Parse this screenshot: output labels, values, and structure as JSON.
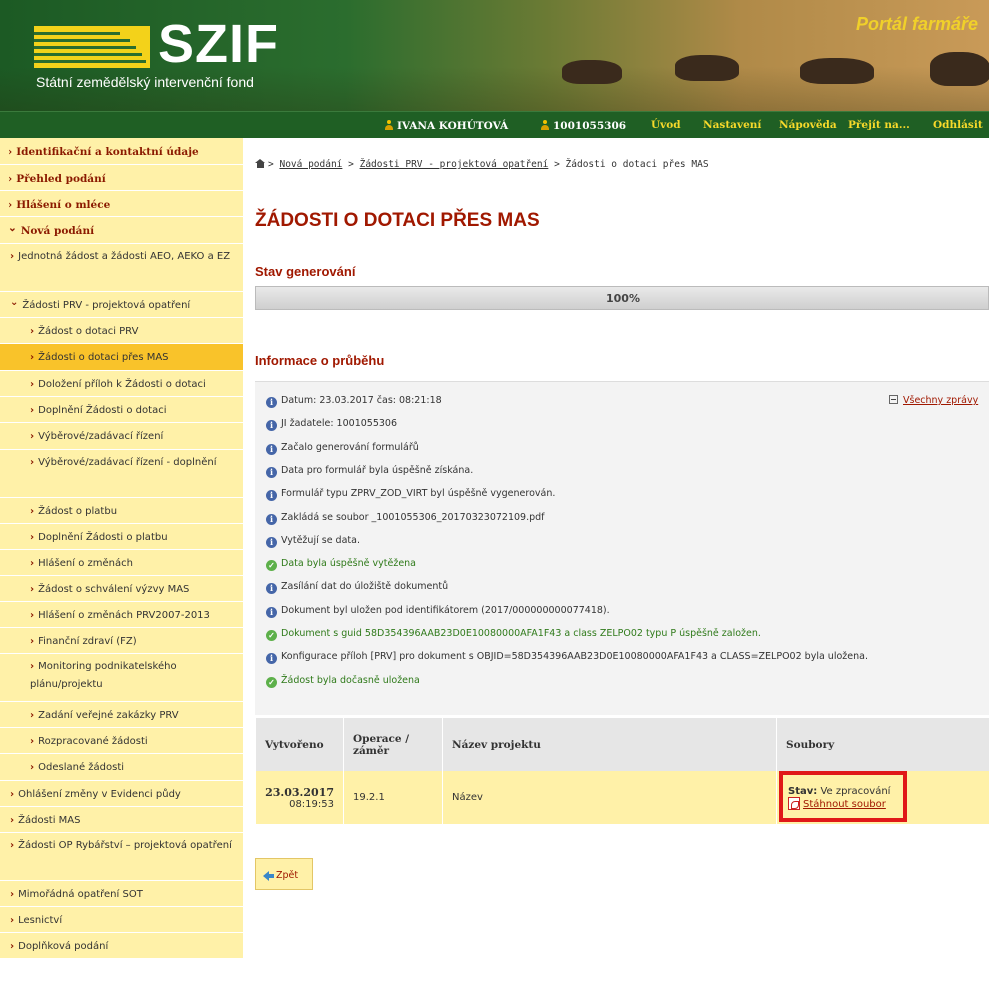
{
  "header": {
    "logo_text": "SZIF",
    "logo_subtitle": "Státní zemědělský intervenční fond",
    "portal_title": "Portál farmáře"
  },
  "navbar": {
    "user_name": "IVANA KOHÚTOVÁ",
    "user_id": "1001055306",
    "items": [
      "Úvod",
      "Nastavení",
      "Nápověda",
      "Přejít na...",
      "Odhlásit"
    ]
  },
  "sidebar": {
    "items": [
      {
        "label": "Identifikační a kontaktní údaje",
        "level": 0
      },
      {
        "label": "Přehled podání",
        "level": 0
      },
      {
        "label": "Hlášení o mléce",
        "level": 0
      },
      {
        "label": "Nová podání",
        "level": 0,
        "expanded": true
      },
      {
        "label": "Jednotná žádost a žádosti AEO, AEKO a EZ",
        "level": 1
      },
      {
        "label": "Žádosti PRV - projektová opatření",
        "level": 1,
        "expanded": true
      },
      {
        "label": "Žádost o dotaci PRV",
        "level": 2
      },
      {
        "label": "Žádosti o dotaci přes MAS",
        "level": 2,
        "active": true
      },
      {
        "label": "Doložení příloh k Žádosti o dotaci",
        "level": 2
      },
      {
        "label": "Doplnění Žádosti o dotaci",
        "level": 2
      },
      {
        "label": "Výběrové/zadávací řízení",
        "level": 2
      },
      {
        "label": "Výběrové/zadávací řízení - doplnění",
        "level": 2
      },
      {
        "label": "Žádost o platbu",
        "level": 2
      },
      {
        "label": "Doplnění Žádosti o platbu",
        "level": 2
      },
      {
        "label": "Hlášení o změnách",
        "level": 2
      },
      {
        "label": "Žádost o schválení výzvy MAS",
        "level": 2
      },
      {
        "label": "Hlášení o změnách PRV2007-2013",
        "level": 2
      },
      {
        "label": "Finanční zdraví (FZ)",
        "level": 2
      },
      {
        "label": "Monitoring podnikatelského plánu/projektu",
        "level": 2
      },
      {
        "label": "Zadání veřejné zakázky PRV",
        "level": 2
      },
      {
        "label": "Rozpracované žádosti",
        "level": 2
      },
      {
        "label": "Odeslané žádosti",
        "level": 2
      },
      {
        "label": "Ohlášení změny v Evidenci půdy",
        "level": 1
      },
      {
        "label": "Žádosti MAS",
        "level": 1
      },
      {
        "label": "Žádosti OP Rybářství – projektová opatření",
        "level": 1
      },
      {
        "label": "Mimořádná opatření SOT",
        "level": 1
      },
      {
        "label": "Lesnictví",
        "level": 1
      },
      {
        "label": "Doplňková podání",
        "level": 1
      }
    ]
  },
  "breadcrumb": {
    "items": [
      "Nová podání",
      "Žádosti PRV - projektová opatření"
    ],
    "current": "Žádosti o dotaci přes MAS",
    "separator": ">"
  },
  "page_title": "ŽÁDOSTI O DOTACI PŘES MAS",
  "generation": {
    "heading": "Stav generování",
    "progress_percent": 100,
    "progress_label": "100%"
  },
  "progress_info": {
    "heading": "Informace o průběhu",
    "all_messages_label": "Všechny zprávy",
    "messages": [
      {
        "type": "info",
        "text": "Datum: 23.03.2017 čas: 08:21:18"
      },
      {
        "type": "info",
        "text": "JI žadatele: 1001055306"
      },
      {
        "type": "info",
        "text": "Začalo generování formulářů"
      },
      {
        "type": "info",
        "text": "Data pro formulář byla úspěšně získána."
      },
      {
        "type": "info",
        "text": "Formulář typu ZPRV_ZOD_VIRT byl úspěšně vygenerován."
      },
      {
        "type": "info",
        "text": "Zakládá se soubor _1001055306_20170323072109.pdf"
      },
      {
        "type": "info",
        "text": "Vytěžují se data."
      },
      {
        "type": "ok",
        "text": "Data byla úspěšně vytěžena"
      },
      {
        "type": "info",
        "text": "Zasílání dat do úložiště dokumentů"
      },
      {
        "type": "info",
        "text": "Dokument byl uložen pod identifikátorem (2017/000000000077418)."
      },
      {
        "type": "ok",
        "text": "Dokument s guid 58D354396AAB23D0E10080000AFA1F43 a class ZELPO02 typu P úspěšně založen."
      },
      {
        "type": "info",
        "text": "Konfigurace příloh [PRV] pro dokument s OBJID=58D354396AAB23D0E10080000AFA1F43 a CLASS=ZELPO02 byla uložena."
      },
      {
        "type": "ok",
        "text": "Žádost byla dočasně uložena"
      }
    ]
  },
  "table": {
    "headers": [
      "Vytvořeno",
      "Operace / záměr",
      "Název projektu",
      "Soubory"
    ],
    "row": {
      "date": "23.03.2017",
      "time": "08:19:53",
      "operation": "19.2.1",
      "name": "Název",
      "status_label": "Stav:",
      "status_value": "Ve zpracování",
      "download_label": "Stáhnout soubor"
    }
  },
  "back_button": {
    "label": "Zpět"
  },
  "colors": {
    "accent_red": "#a01800",
    "sidebar_bg": "#fff1a8",
    "sidebar_active": "#f9c32a",
    "nav_green": "#1f5f24",
    "nav_text": "#f7d92a",
    "highlight_border": "#e01818"
  }
}
